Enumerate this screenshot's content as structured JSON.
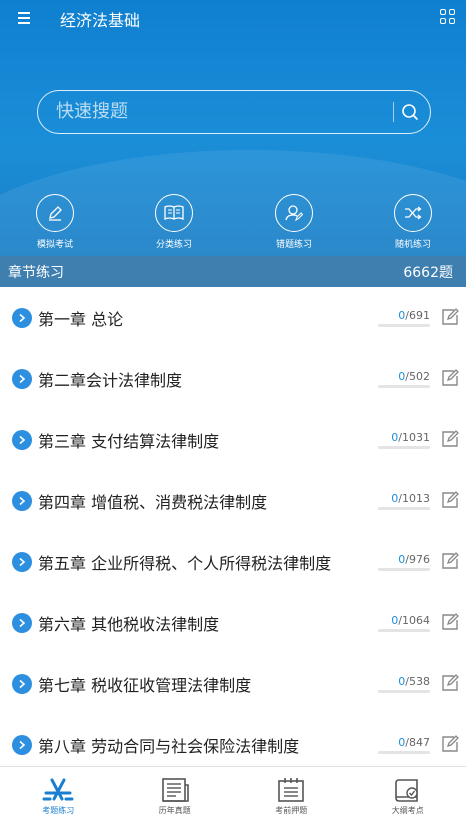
{
  "header": {
    "title": "经济法基础"
  },
  "search": {
    "placeholder": "快速搜题"
  },
  "quick_actions": [
    {
      "label": "模拟考试",
      "icon": "pencil-icon"
    },
    {
      "label": "分类练习",
      "icon": "book-icon"
    },
    {
      "label": "错题练习",
      "icon": "user-edit-icon"
    },
    {
      "label": "随机练习",
      "icon": "shuffle-icon"
    }
  ],
  "section": {
    "title": "章节练习",
    "count": "6662题"
  },
  "chapters": [
    {
      "name": "第一章 总论",
      "done": "0",
      "total": "/691",
      "progress": 0
    },
    {
      "name": "第二章会计法律制度",
      "done": "0",
      "total": "/502",
      "progress": 0
    },
    {
      "name": "第三章 支付结算法律制度",
      "done": "0",
      "total": "/1031",
      "progress": 0
    },
    {
      "name": "第四章 增值税、消费税法律制度",
      "done": "0",
      "total": "/1013",
      "progress": 0
    },
    {
      "name": "第五章 企业所得税、个人所得税法律制度",
      "done": "0",
      "total": "/976",
      "progress": 0
    },
    {
      "name": "第六章 其他税收法律制度",
      "done": "0",
      "total": "/1064",
      "progress": 0
    },
    {
      "name": "第七章 税收征收管理法律制度",
      "done": "0",
      "total": "/538",
      "progress": 0
    },
    {
      "name": "第八章 劳动合同与社会保险法律制度",
      "done": "0",
      "total": "/847",
      "progress": 0
    }
  ],
  "tabs": [
    {
      "label": "考题练习",
      "icon": "app-store-icon",
      "active": true
    },
    {
      "label": "历年真题",
      "icon": "newspaper-icon",
      "active": false
    },
    {
      "label": "考前押题",
      "icon": "calendar-icon",
      "active": false
    },
    {
      "label": "大纲考点",
      "icon": "book-check-icon",
      "active": false
    }
  ],
  "colors": {
    "accent": "#1a7fd0",
    "header_blue": "#1b8ed8",
    "section_bar": "#3e7fb0"
  }
}
